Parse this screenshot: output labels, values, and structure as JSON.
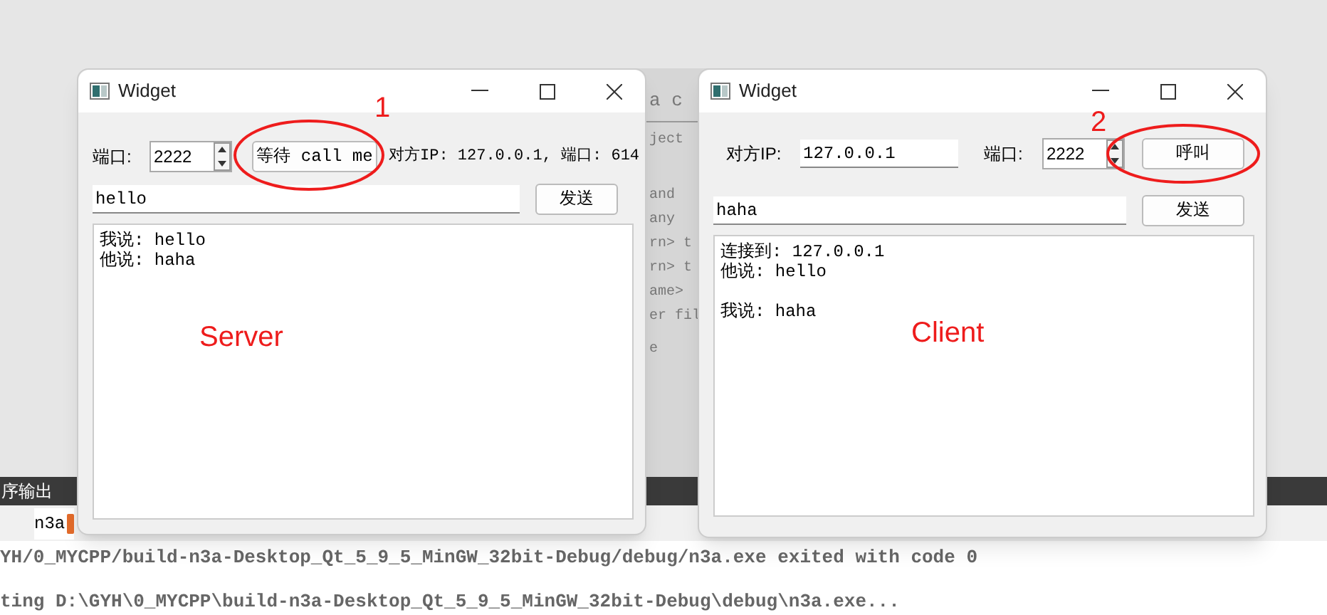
{
  "background_editor": {
    "lines": [
      "a c",
      "ject",
      "and",
      "any",
      "rn> t",
      "rn> t",
      "ame>",
      "er fil",
      "e"
    ]
  },
  "server_window": {
    "title": "Widget",
    "port_label": "端口:",
    "port_value": "2222",
    "wait_button": "等待 call me",
    "peer_label": "对方IP: 127.0.0.1, 端口: 614",
    "message_value": "hello",
    "send_button": "发送",
    "log": [
      [
        "我说: hello",
        "他说: haha"
      ]
    ]
  },
  "client_window": {
    "title": "Widget",
    "ip_label": "对方IP:",
    "ip_value": "127.0.0.1",
    "port_label": "端口:",
    "port_value": "2222",
    "call_button": "呼叫",
    "message_value": "haha",
    "send_button": "发送",
    "log": [
      [
        "连接到: 127.0.0.1",
        "他说: hello"
      ],
      [
        "我说: haha"
      ]
    ]
  },
  "annotations": [
    {
      "kind": "number",
      "text": "1"
    },
    {
      "kind": "number",
      "text": "2"
    },
    {
      "kind": "label",
      "text": "Server"
    },
    {
      "kind": "label",
      "text": "Client"
    }
  ],
  "output_panel": {
    "title": "序输出",
    "tab": "n3a",
    "lines": [
      "YH/0_MYCPP/build-n3a-Desktop_Qt_5_9_5_MinGW_32bit-Debug/debug/n3a.exe exited with code 0",
      "ting D:\\GYH\\0_MYCPP\\build-n3a-Desktop_Qt_5_9_5_MinGW_32bit-Debug\\debug\\n3a.exe..."
    ]
  }
}
